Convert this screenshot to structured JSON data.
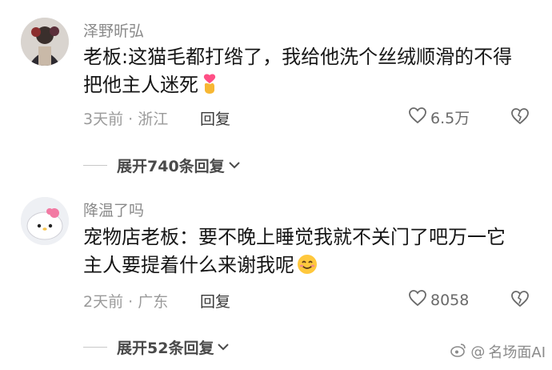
{
  "comments": [
    {
      "username": "泽野昕弘",
      "text_line1": "老板:这猫毛都打绺了，我给他洗个丝绒顺滑的不得",
      "text_line2": "把他主人迷死",
      "emoji": "finger-heart-emoji",
      "time": "3天前",
      "location": "浙江",
      "reply_label": "回复",
      "like_count": "6.5万",
      "expand_label": "展开740条回复"
    },
    {
      "username": "降温了吗",
      "text_line1": "宠物店老板：要不晚上睡觉我就不关门了吧万一它",
      "text_line2": "主人要提着什么来谢我呢",
      "emoji": "smiling-face-emoji",
      "time": "2天前",
      "location": "广东",
      "reply_label": "回复",
      "like_count": "8058",
      "expand_label": "展开52条回复"
    }
  ],
  "meta_separator": " · ",
  "watermark": {
    "prefix": "@",
    "text": "名场面AI"
  },
  "colors": {
    "username": "#8a8a8a",
    "text": "#161616",
    "meta": "#9a9a9a",
    "reply": "#3a3a3a",
    "expand": "#4a4a4a"
  }
}
